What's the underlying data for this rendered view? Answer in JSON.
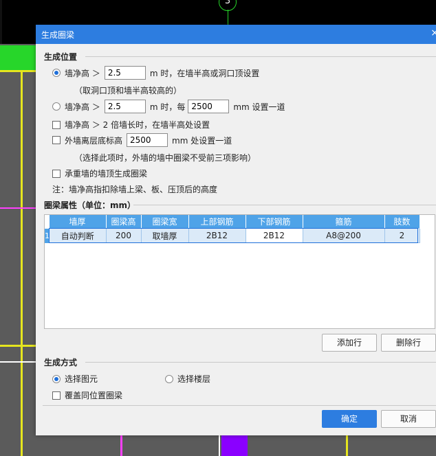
{
  "background": {
    "axis_label": "3"
  },
  "dialog": {
    "title": "生成圈梁",
    "close": "×",
    "position_section": {
      "title": "生成位置",
      "opt1": {
        "prefix": "墙净高 ＞",
        "value": "2.5",
        "suffix": "m 时，在墙半高或洞口顶设置",
        "note": "（取洞口顶和墙半高较高的）"
      },
      "opt2": {
        "prefix": "墙净高 ＞",
        "value": "2.5",
        "mid": "m 时，每",
        "value2": "2500",
        "suffix": "mm 设置一道"
      },
      "opt3": {
        "label": "墙净高 ＞ 2 倍墙长时，在墙半高处设置"
      },
      "opt4": {
        "prefix": "外墙离层底标高",
        "value": "2500",
        "suffix": "mm 处设置一道",
        "note": "（选择此项时，外墙的墙中圈梁不受前三项影响）"
      },
      "opt5": {
        "label": "承重墙的墙顶生成圈梁"
      },
      "footnote": "注：墙净高指扣除墙上梁、板、压顶后的高度"
    },
    "attr_section": {
      "title": "圈梁属性（单位：mm）",
      "columns": [
        "墙厚",
        "圈梁高",
        "圈梁宽",
        "上部钢筋",
        "下部钢筋",
        "箍筋",
        "肢数"
      ],
      "rows": [
        {
          "index": "1",
          "cells": [
            "自动判断",
            "200",
            "取墙厚",
            "2B12",
            "2B12",
            "A8@200",
            "2"
          ]
        }
      ],
      "add_label": "添加行",
      "delete_label": "删除行"
    },
    "method_section": {
      "title": "生成方式",
      "opt_element": "选择图元",
      "opt_floor": "选择楼层",
      "overwrite": "覆盖同位置圈梁"
    },
    "ok_label": "确定",
    "cancel_label": "取消"
  }
}
